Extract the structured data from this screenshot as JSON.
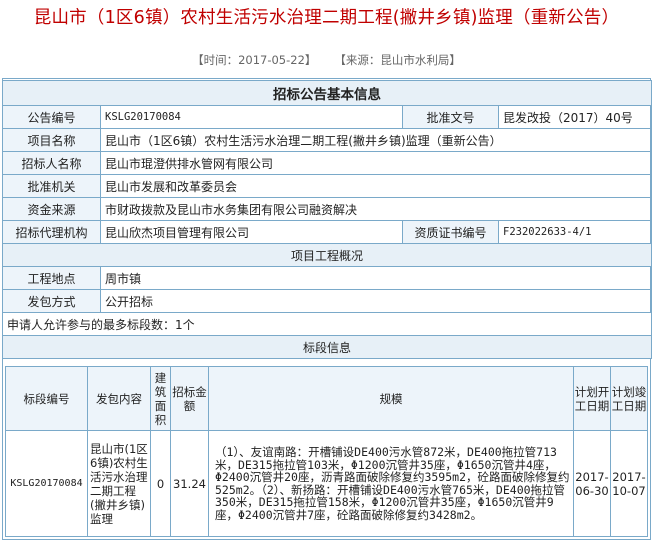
{
  "page": {
    "title": "昆山市（1区6镇）农村生活污水治理二期工程(撇井乡镇)监理（重新公告）",
    "date_label": "【时间：2017-05-22】",
    "source_label": "【来源：昆山市水利局】"
  },
  "basic": {
    "heading": "招标公告基本信息",
    "notice_no_label": "公告编号",
    "notice_no": "KSLG20170084",
    "approval_doc_label": "批准文号",
    "approval_doc": "昆发改投（2017）40号",
    "project_name_label": "项目名称",
    "project_name": "昆山市（1区6镇）农村生活污水治理二期工程(撇井乡镇)监理（重新公告）",
    "tenderer_label": "招标人名称",
    "tenderer": "昆山市琨澄供排水管网有限公司",
    "approver_label": "批准机关",
    "approver": "昆山市发展和改革委员会",
    "funding_label": "资金来源",
    "funding": "市财政拨款及昆山市水务集团有限公司融资解决",
    "agency_label": "招标代理机构",
    "agency": "昆山欣杰项目管理有限公司",
    "cert_label": "资质证书编号",
    "cert": "F232022633-4/1"
  },
  "project": {
    "heading": "项目工程概况",
    "location_label": "工程地点",
    "location": "周市镇",
    "method_label": "发包方式",
    "method": "公开招标",
    "max_bids_text": "申请人允许参与的最多标段数：1个"
  },
  "sections": {
    "heading": "标段信息",
    "columns": [
      "标段编号",
      "发包内容",
      "建筑面积",
      "招标金额",
      "规模",
      "计划开工日期",
      "计划竣工日期"
    ],
    "rows": [
      {
        "id": "KSLG20170084",
        "content": "昆山市(1区6镇)农村生活污水治理二期工程(撇井乡镇)监理",
        "area": "0",
        "amount": "31.24",
        "scale": "（1）、友谊南路：开槽铺设DE400污水管872米，DE400拖拉管713米，DE315拖拉管103米，Φ1200沉管井35座，Φ1650沉管井4座，Φ2400沉管井20座，沥青路面破除修复约3595m2，砼路面破除修复约525m2。（2）、新扬路：开槽铺设DE400污水管765米，DE400拖拉管350米，DE315拖拉管158米，Φ1200沉管井35座，Φ1650沉管井9座，Φ2400沉管井7座，砼路面破除修复约3428m2。",
        "start": "2017-06-30",
        "end": "2017-10-07"
      }
    ]
  }
}
